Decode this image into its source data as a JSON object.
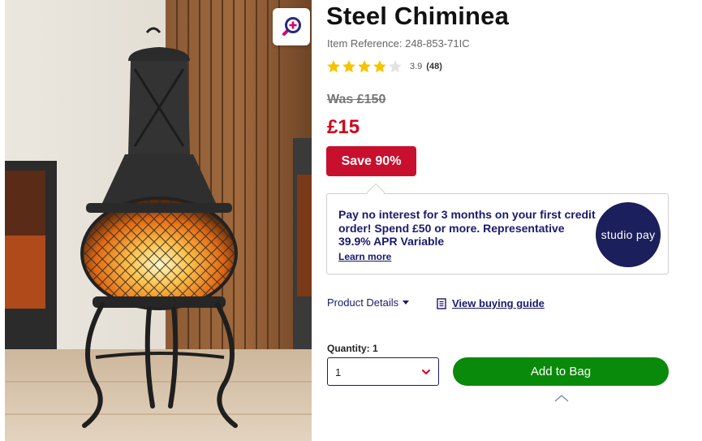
{
  "product": {
    "title": "Steel Chiminea",
    "item_reference": "Item Reference: 248-853-71IC",
    "rating": 3.9,
    "rating_value_text": "3.9",
    "rating_count_text": "(48)",
    "was_price": "Was £150",
    "now_price": "£15",
    "save_badge": "Save 90%"
  },
  "promo": {
    "text": "Pay no interest for 3 months on your first credit order! Spend £50 or more. Representative 39.9% APR Variable",
    "link_label": "Learn more",
    "logo_text": "studio pay"
  },
  "links": {
    "product_details": "Product Details",
    "buying_guide": "View buying guide"
  },
  "purchase": {
    "quantity_label": "Quantity: 1",
    "quantity_value": "1",
    "add_to_bag": "Add to Bag"
  },
  "icons": {
    "zoom": "zoom-in-icon",
    "star": "star-icon",
    "caret": "caret-down-icon",
    "guide": "book-icon",
    "chevron": "chevron-down-icon",
    "scroll_top": "chevron-up-icon"
  },
  "colors": {
    "price_red": "#d0021b",
    "badge_red": "#c8102e",
    "navy": "#1a1a6e",
    "star_yellow": "#f5c400",
    "button_green": "#0a8a0a",
    "logo_navy": "#1b1f5c"
  }
}
